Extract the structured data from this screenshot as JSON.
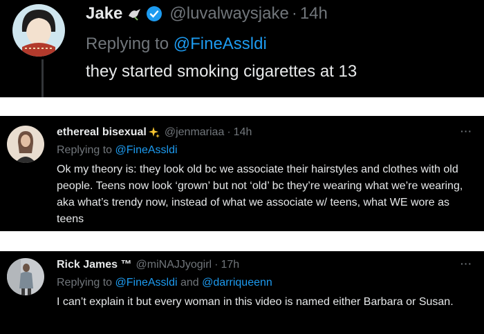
{
  "tweets": [
    {
      "name": "Jake",
      "handle": "@luvalwaysjake",
      "time": "14h",
      "replying_label": "Replying to",
      "replying_to": "@FineAssldi",
      "text": "they started smoking cigarettes at 13",
      "icons": [
        "dove-emoji-icon",
        "verified-badge-icon"
      ]
    },
    {
      "name": "ethereal bisexual",
      "handle": "@jenmariaa",
      "time": "14h",
      "replying_label": "Replying to",
      "replying_to": "@FineAssldi",
      "text": "Ok my theory is: they look old bc we associate their hairstyles and clothes with old people. Teens now look ‘grown’ but not ‘old’ bc they’re wearing what we’re wearing, aka what’s trendy now, instead of what we associate w/ teens, what WE wore as teens",
      "icons": [
        "sparkles-emoji-icon",
        "more-options-icon"
      ]
    },
    {
      "name": "Rick James ™",
      "handle": "@miNAJJyogirl",
      "time": "17h",
      "replying_label": "Replying to",
      "replying_to": "@FineAssldi",
      "and_label": "and",
      "replying_to_2": "@darriqueenn",
      "text": "I can’t explain it but every woman in this video is named either Barbara or Susan.",
      "icons": [
        "more-options-icon"
      ]
    }
  ],
  "colors": {
    "background": "#000000",
    "text": "#e7e9ea",
    "muted": "#71767b",
    "link": "#1d9bf0",
    "verified": "#1d9bf0"
  }
}
